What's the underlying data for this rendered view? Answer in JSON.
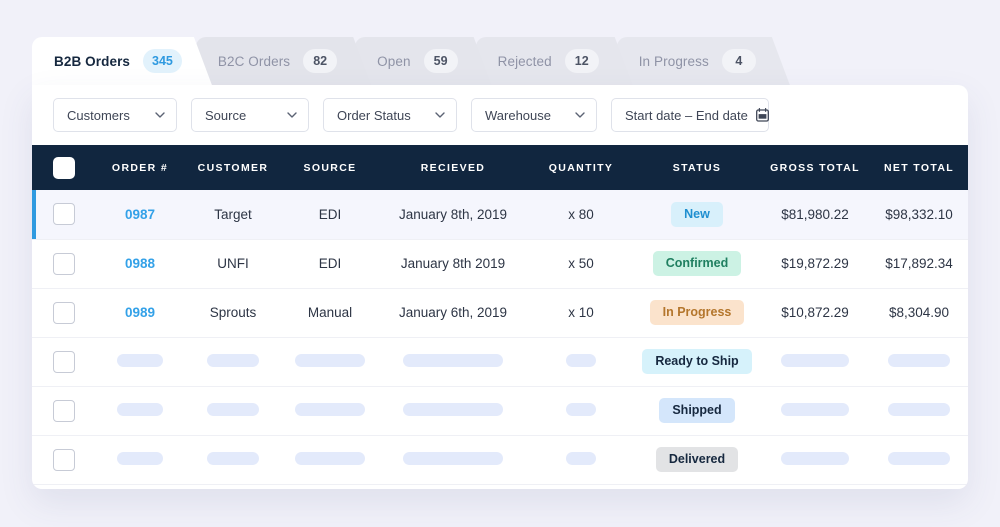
{
  "theme": {
    "page_background": "#f1f1f9",
    "card_background": "#ffffff",
    "header_background": "#11263f",
    "accent_blue": "#2f9ae0",
    "link_blue": "#33a1e8",
    "active_row_background": "#f5f6fd"
  },
  "tabs": [
    {
      "label": "B2B Orders",
      "count": "345",
      "active": true
    },
    {
      "label": "B2C Orders",
      "count": "82",
      "active": false
    },
    {
      "label": "Open",
      "count": "59",
      "active": false
    },
    {
      "label": "Rejected",
      "count": "12",
      "active": false
    },
    {
      "label": "In Progress",
      "count": "4",
      "active": false
    }
  ],
  "filters": [
    {
      "name": "customers",
      "value": "Customers",
      "icon": "chevron-down-icon"
    },
    {
      "name": "source",
      "value": "Source",
      "icon": "chevron-down-icon"
    },
    {
      "name": "order-status",
      "value": "Order Status",
      "icon": "chevron-down-icon"
    },
    {
      "name": "warehouse",
      "value": "Warehouse",
      "icon": "chevron-down-icon"
    },
    {
      "name": "date-range",
      "value": "Start date – End date",
      "icon": "calendar-icon"
    }
  ],
  "table": {
    "columns": [
      "ORDER #",
      "CUSTOMER",
      "SOURCE",
      "RECIEVED",
      "QUANTITY",
      "STATUS",
      "GROSS TOTAL",
      "NET TOTAL"
    ],
    "rows": [
      {
        "loaded": true,
        "highlight": true,
        "order": "0987",
        "customer": "Target",
        "source": "EDI",
        "recieved": "January 8th, 2019",
        "quantity": "x 80",
        "status": "New",
        "status_class": "new",
        "gross_total": "$81,980.22",
        "net_total": "$98,332.10"
      },
      {
        "loaded": true,
        "highlight": false,
        "order": "0988",
        "customer": "UNFI",
        "source": "EDI",
        "recieved": "January 8th 2019",
        "quantity": "x 50",
        "status": "Confirmed",
        "status_class": "confirmed",
        "gross_total": "$19,872.29",
        "net_total": "$17,892.34"
      },
      {
        "loaded": true,
        "highlight": false,
        "order": "0989",
        "customer": "Sprouts",
        "source": "Manual",
        "recieved": "January 6th, 2019",
        "quantity": "x 10",
        "status": "In Progress",
        "status_class": "inprogress",
        "gross_total": "$10,872.29",
        "net_total": "$8,304.90"
      },
      {
        "loaded": false,
        "highlight": false,
        "order": "",
        "customer": "",
        "source": "",
        "recieved": "",
        "quantity": "",
        "status": "Ready to Ship",
        "status_class": "ready",
        "gross_total": "",
        "net_total": ""
      },
      {
        "loaded": false,
        "highlight": false,
        "order": "",
        "customer": "",
        "source": "",
        "recieved": "",
        "quantity": "",
        "status": "Shipped",
        "status_class": "shipped",
        "gross_total": "",
        "net_total": ""
      },
      {
        "loaded": false,
        "highlight": false,
        "order": "",
        "customer": "",
        "source": "",
        "recieved": "",
        "quantity": "",
        "status": "Delivered",
        "status_class": "delivered",
        "gross_total": "",
        "net_total": ""
      }
    ]
  }
}
